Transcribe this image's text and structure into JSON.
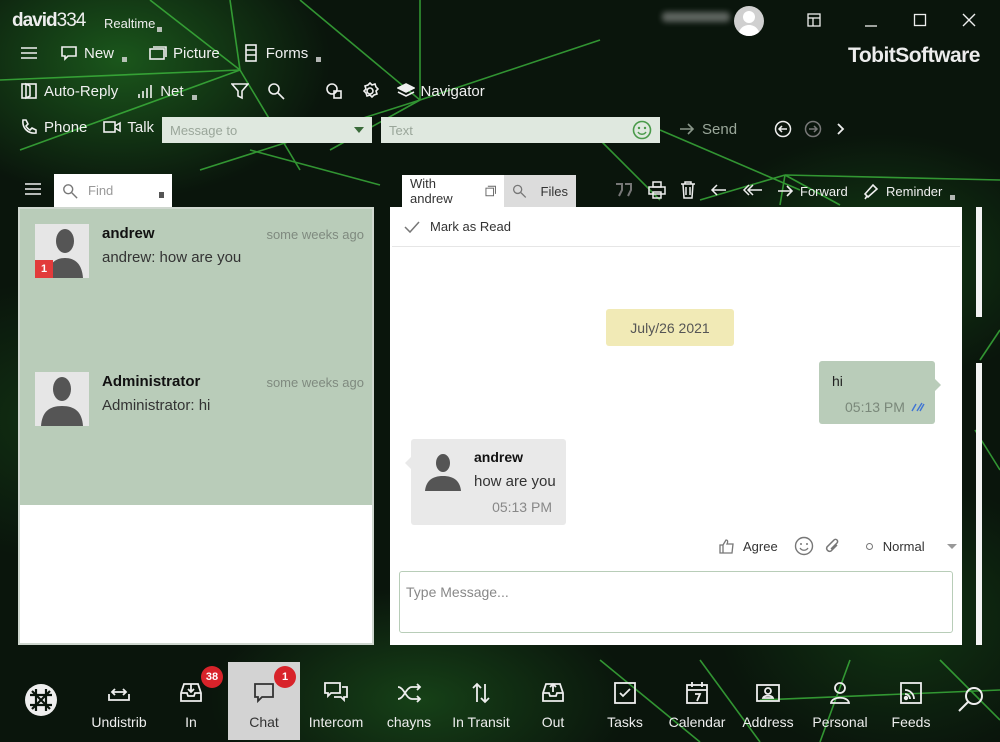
{
  "titlebar": {
    "user_bold": "david",
    "user_num": "334",
    "mode": "Realtime",
    "brand": "TobitSoftware"
  },
  "toolbar": {
    "row1": [
      {
        "label": "New",
        "icon": "chat-bubble-icon"
      },
      {
        "label": "Picture",
        "icon": "picture-icon"
      },
      {
        "label": "Forms",
        "icon": "forms-icon"
      }
    ],
    "row2": [
      {
        "label": "Auto-Reply",
        "icon": "auto-reply-icon"
      },
      {
        "label": "Net",
        "icon": "signal-icon"
      },
      {
        "label": "Navigator",
        "icon": "layers-icon"
      }
    ],
    "row3": {
      "phone": "Phone",
      "talk": "Talk",
      "message_to_placeholder": "Message to",
      "text_placeholder": "Text",
      "send": "Send"
    }
  },
  "sidebar": {
    "find_placeholder": "Find",
    "conversations": [
      {
        "name": "andrew",
        "preview": "andrew: how are you",
        "time": "some weeks ago",
        "unread": "1"
      },
      {
        "name": "Administrator",
        "preview": "Administrator: hi",
        "time": "some weeks ago",
        "unread": ""
      }
    ]
  },
  "chat": {
    "tabs": [
      {
        "label": "With andrew",
        "active": true
      },
      {
        "label": "Files",
        "active": false
      }
    ],
    "actions": {
      "forward": "Forward",
      "reminder": "Reminder"
    },
    "mark_as_read": "Mark as Read",
    "date": "July/26 2021",
    "messages": [
      {
        "from": "me",
        "text": "hi",
        "time": "05:13 PM",
        "status": "read"
      },
      {
        "from": "andrew",
        "text": "how are you",
        "time": "05:13 PM"
      }
    ],
    "compose": {
      "agree": "Agree",
      "priority": "Normal",
      "placeholder": "Type Message..."
    }
  },
  "bottom_nav": [
    {
      "label": "Undistrib",
      "icon": "undistributed-icon",
      "badge": ""
    },
    {
      "label": "In",
      "icon": "inbox-icon",
      "badge": "38"
    },
    {
      "label": "Chat",
      "icon": "chat-icon",
      "badge": "1",
      "active": true
    },
    {
      "label": "Intercom",
      "icon": "intercom-icon",
      "badge": ""
    },
    {
      "label": "chayns",
      "icon": "chayns-icon",
      "badge": ""
    },
    {
      "label": "In Transit",
      "icon": "transit-icon",
      "badge": ""
    },
    {
      "label": "Out",
      "icon": "outbox-icon",
      "badge": ""
    },
    {
      "label": "Tasks",
      "icon": "tasks-icon",
      "badge": ""
    },
    {
      "label": "Calendar",
      "icon": "calendar-icon",
      "badge": "",
      "day": "7"
    },
    {
      "label": "Address",
      "icon": "address-icon",
      "badge": ""
    },
    {
      "label": "Personal",
      "icon": "personal-icon",
      "badge": ""
    },
    {
      "label": "Feeds",
      "icon": "feeds-icon",
      "badge": ""
    }
  ],
  "colors": {
    "accent_green": "#b9ccb9",
    "badge_red": "#d8232a",
    "date_chip": "#f1eab6"
  }
}
